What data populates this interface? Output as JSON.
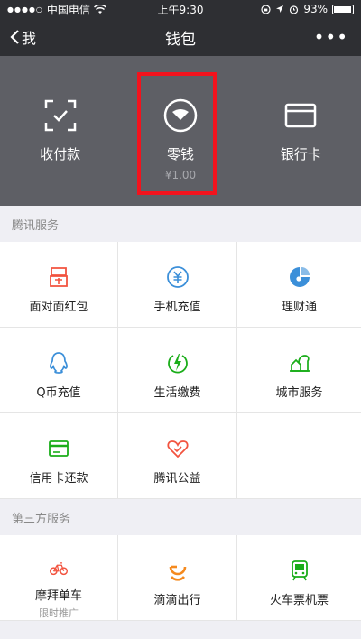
{
  "status_bar": {
    "carrier": "中国电信",
    "time": "上午9:30",
    "battery": "93%",
    "battery_level": 0.93
  },
  "nav": {
    "back_label": "我",
    "title": "钱包"
  },
  "hero": {
    "items": [
      {
        "label": "收付款",
        "icon": "scan-pay-icon"
      },
      {
        "label": "零钱",
        "sub": "¥1.00",
        "icon": "wallet-change-icon"
      },
      {
        "label": "银行卡",
        "icon": "bank-card-icon"
      }
    ]
  },
  "sections": [
    {
      "title": "腾讯服务",
      "items": [
        {
          "label": "面对面红包",
          "icon": "red-packet-icon",
          "color": "#f2533f"
        },
        {
          "label": "手机充值",
          "icon": "phone-recharge-icon",
          "color": "#3b8fd9"
        },
        {
          "label": "理财通",
          "icon": "wealth-icon",
          "color": "#3b8fd9"
        },
        {
          "label": "Q币充值",
          "icon": "qq-coin-icon",
          "color": "#3b8fd9"
        },
        {
          "label": "生活缴费",
          "icon": "utility-bill-icon",
          "color": "#1aad19"
        },
        {
          "label": "城市服务",
          "icon": "city-service-icon",
          "color": "#1aad19"
        },
        {
          "label": "信用卡还款",
          "icon": "credit-card-icon",
          "color": "#1aad19"
        },
        {
          "label": "腾讯公益",
          "icon": "charity-heart-icon",
          "color": "#f2533f"
        }
      ]
    },
    {
      "title": "第三方服务",
      "items": [
        {
          "label": "摩拜单车",
          "sub": "限时推广",
          "icon": "bike-icon",
          "color": "#f2533f"
        },
        {
          "label": "滴滴出行",
          "icon": "didi-icon",
          "color": "#f58a1f"
        },
        {
          "label": "火车票机票",
          "icon": "train-icon",
          "color": "#1aad19"
        }
      ]
    }
  ]
}
